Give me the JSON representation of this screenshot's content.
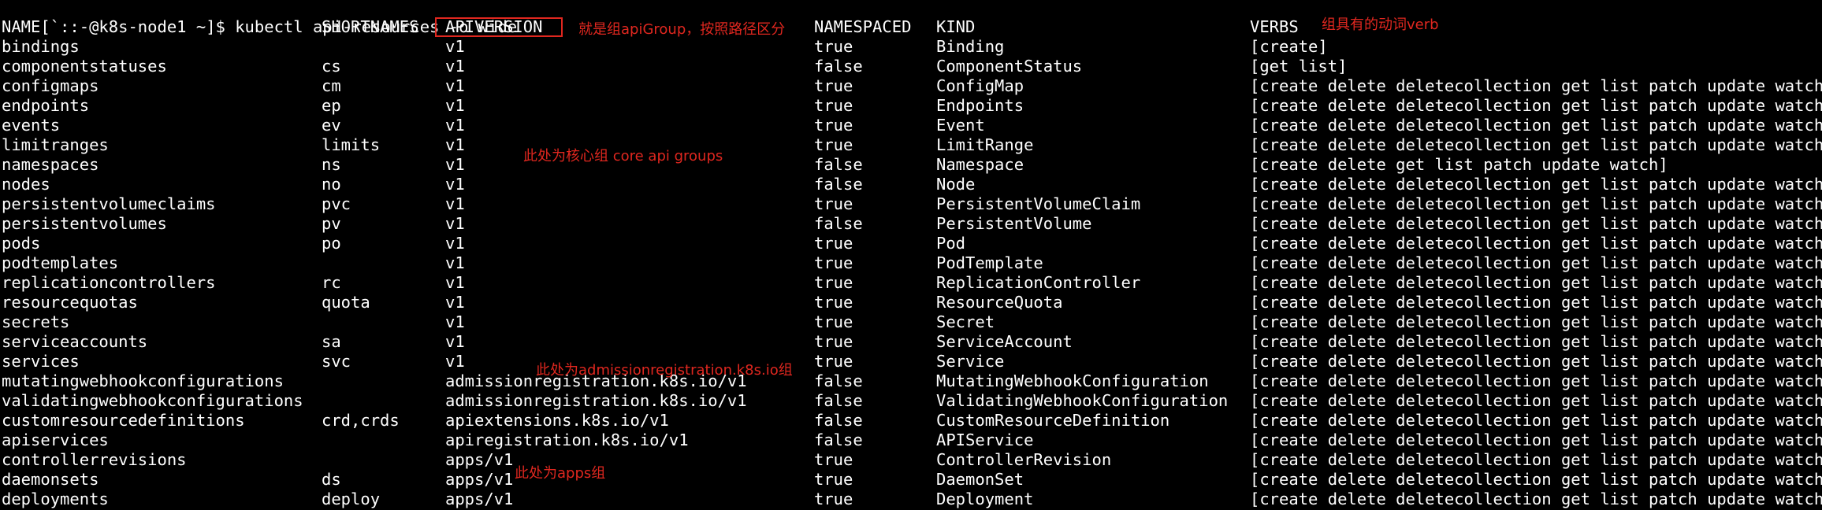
{
  "terminal": {
    "prompt": "[`::-@k8s-node1 ~]$ ",
    "command": "kubectl api-resources -o wide"
  },
  "headers": {
    "name": "NAME",
    "shortnames": "SHORTNAMES",
    "apiversion": "APIVERSION",
    "namespaced": "NAMESPACED",
    "kind": "KIND",
    "verbs": "VERBS"
  },
  "rows": [
    {
      "name": "bindings",
      "short": "",
      "api": "v1",
      "ns": "true",
      "kind": "Binding",
      "verbs": "[create]"
    },
    {
      "name": "componentstatuses",
      "short": "cs",
      "api": "v1",
      "ns": "false",
      "kind": "ComponentStatus",
      "verbs": "[get list]"
    },
    {
      "name": "configmaps",
      "short": "cm",
      "api": "v1",
      "ns": "true",
      "kind": "ConfigMap",
      "verbs": "[create delete deletecollection get list patch update watch]"
    },
    {
      "name": "endpoints",
      "short": "ep",
      "api": "v1",
      "ns": "true",
      "kind": "Endpoints",
      "verbs": "[create delete deletecollection get list patch update watch]"
    },
    {
      "name": "events",
      "short": "ev",
      "api": "v1",
      "ns": "true",
      "kind": "Event",
      "verbs": "[create delete deletecollection get list patch update watch]"
    },
    {
      "name": "limitranges",
      "short": "limits",
      "api": "v1",
      "ns": "true",
      "kind": "LimitRange",
      "verbs": "[create delete deletecollection get list patch update watch]"
    },
    {
      "name": "namespaces",
      "short": "ns",
      "api": "v1",
      "ns": "false",
      "kind": "Namespace",
      "verbs": "[create delete get list patch update watch]"
    },
    {
      "name": "nodes",
      "short": "no",
      "api": "v1",
      "ns": "false",
      "kind": "Node",
      "verbs": "[create delete deletecollection get list patch update watch]"
    },
    {
      "name": "persistentvolumeclaims",
      "short": "pvc",
      "api": "v1",
      "ns": "true",
      "kind": "PersistentVolumeClaim",
      "verbs": "[create delete deletecollection get list patch update watch]"
    },
    {
      "name": "persistentvolumes",
      "short": "pv",
      "api": "v1",
      "ns": "false",
      "kind": "PersistentVolume",
      "verbs": "[create delete deletecollection get list patch update watch]"
    },
    {
      "name": "pods",
      "short": "po",
      "api": "v1",
      "ns": "true",
      "kind": "Pod",
      "verbs": "[create delete deletecollection get list patch update watch]"
    },
    {
      "name": "podtemplates",
      "short": "",
      "api": "v1",
      "ns": "true",
      "kind": "PodTemplate",
      "verbs": "[create delete deletecollection get list patch update watch]"
    },
    {
      "name": "replicationcontrollers",
      "short": "rc",
      "api": "v1",
      "ns": "true",
      "kind": "ReplicationController",
      "verbs": "[create delete deletecollection get list patch update watch]"
    },
    {
      "name": "resourcequotas",
      "short": "quota",
      "api": "v1",
      "ns": "true",
      "kind": "ResourceQuota",
      "verbs": "[create delete deletecollection get list patch update watch]"
    },
    {
      "name": "secrets",
      "short": "",
      "api": "v1",
      "ns": "true",
      "kind": "Secret",
      "verbs": "[create delete deletecollection get list patch update watch]"
    },
    {
      "name": "serviceaccounts",
      "short": "sa",
      "api": "v1",
      "ns": "true",
      "kind": "ServiceAccount",
      "verbs": "[create delete deletecollection get list patch update watch]"
    },
    {
      "name": "services",
      "short": "svc",
      "api": "v1",
      "ns": "true",
      "kind": "Service",
      "verbs": "[create delete deletecollection get list patch update watch]"
    },
    {
      "name": "mutatingwebhookconfigurations",
      "short": "",
      "api": "admissionregistration.k8s.io/v1",
      "ns": "false",
      "kind": "MutatingWebhookConfiguration",
      "verbs": "[create delete deletecollection get list patch update watch]"
    },
    {
      "name": "validatingwebhookconfigurations",
      "short": "",
      "api": "admissionregistration.k8s.io/v1",
      "ns": "false",
      "kind": "ValidatingWebhookConfiguration",
      "verbs": "[create delete deletecollection get list patch update watch]"
    },
    {
      "name": "customresourcedefinitions",
      "short": "crd,crds",
      "api": "apiextensions.k8s.io/v1",
      "ns": "false",
      "kind": "CustomResourceDefinition",
      "verbs": "[create delete deletecollection get list patch update watch]"
    },
    {
      "name": "apiservices",
      "short": "",
      "api": "apiregistration.k8s.io/v1",
      "ns": "false",
      "kind": "APIService",
      "verbs": "[create delete deletecollection get list patch update watch]"
    },
    {
      "name": "controllerrevisions",
      "short": "",
      "api": "apps/v1",
      "ns": "true",
      "kind": "ControllerRevision",
      "verbs": "[create delete deletecollection get list patch update watch]"
    },
    {
      "name": "daemonsets",
      "short": "ds",
      "api": "apps/v1",
      "ns": "true",
      "kind": "DaemonSet",
      "verbs": "[create delete deletecollection get list patch update watch]"
    },
    {
      "name": "deployments",
      "short": "deploy",
      "api": "apps/v1",
      "ns": "true",
      "kind": "Deployment",
      "verbs": "[create delete deletecollection get list patch update watch]"
    }
  ],
  "annotations": {
    "apigroup": "就是组apiGroup，按照路径区分",
    "verbs": "组具有的动词verb",
    "core": "此处为核心组 core api groups",
    "admission": "此处为admissionregistration.k8s.io组",
    "apps": "此处为apps组"
  },
  "colors": {
    "background": "#000000",
    "text": "#ffffff",
    "annotation": "#e0271f"
  }
}
